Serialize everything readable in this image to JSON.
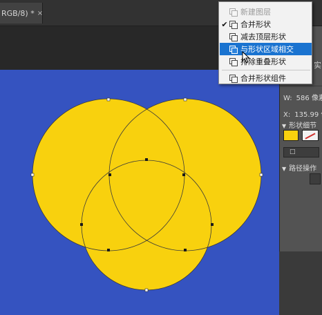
{
  "document": {
    "tab_title": "RGB/8) *",
    "close_glyph": "×"
  },
  "menu": {
    "items": [
      {
        "label": "新建图层",
        "checked": false,
        "disabled": true,
        "highlighted": false,
        "icon": "new-layer-icon"
      },
      {
        "label": "合并形状",
        "checked": true,
        "disabled": false,
        "highlighted": false,
        "icon": "combine-shapes-icon"
      },
      {
        "label": "减去顶层形状",
        "checked": false,
        "disabled": false,
        "highlighted": false,
        "icon": "subtract-front-shape-icon"
      },
      {
        "label": "与形状区域相交",
        "checked": false,
        "disabled": false,
        "highlighted": true,
        "icon": "intersect-shape-areas-icon"
      },
      {
        "label": "排除重叠形状",
        "checked": false,
        "disabled": false,
        "highlighted": false,
        "icon": "exclude-overlapping-shapes-icon"
      },
      {
        "label": "合并形状组件",
        "checked": false,
        "disabled": false,
        "highlighted": false,
        "icon": "merge-shape-components-icon"
      }
    ],
    "check_glyph": "✔"
  },
  "properties": {
    "top_label": "实",
    "width_label": "W:",
    "width_value": "586 像素",
    "x_label": "X:",
    "x_value": "135.99 像",
    "shape_details_label": "形状细节",
    "path_ops_label": "路径操作",
    "stroke_dropdown_glyph": "□"
  },
  "canvas": {
    "background_color": "#3553c0",
    "shape_fill_color": "#f8d10e",
    "path_color": "#3a3a3a"
  },
  "colors": {
    "menu_highlight": "#1a73d0",
    "panel": "#535353",
    "stroke_swatch_slash": "#d0312d"
  }
}
